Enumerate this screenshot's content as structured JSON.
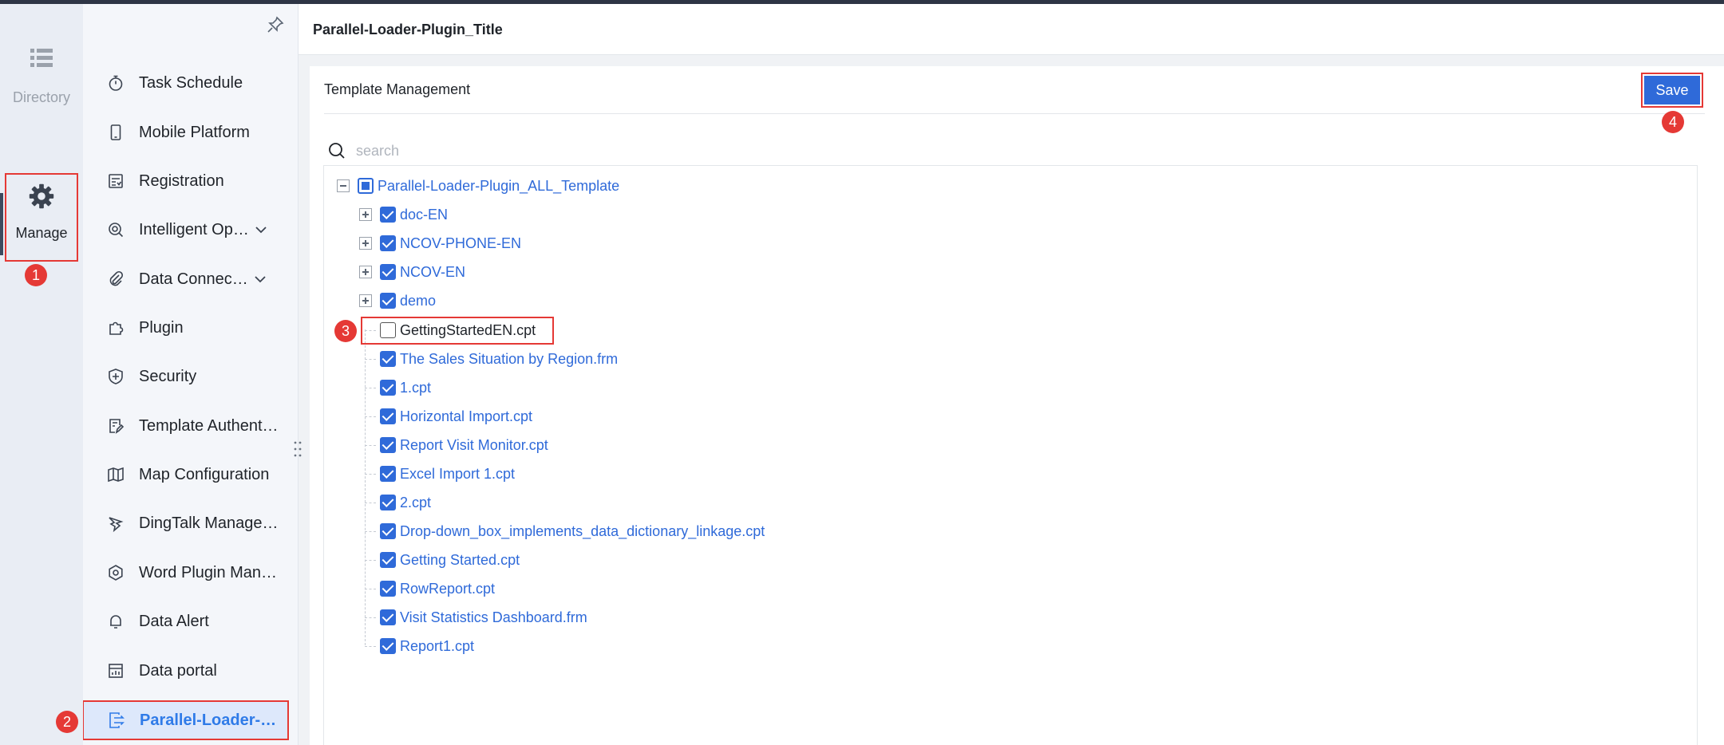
{
  "rail": {
    "directory_label": "Directory",
    "manage_label": "Manage"
  },
  "sidebar": {
    "items": [
      {
        "label": "Task Schedule",
        "icon": "stopwatch-icon"
      },
      {
        "label": "Mobile Platform",
        "icon": "mobile-icon"
      },
      {
        "label": "Registration",
        "icon": "registration-icon"
      },
      {
        "label": "Intelligent Op…",
        "icon": "intelligent-ops-icon",
        "expandable": true
      },
      {
        "label": "Data Connec…",
        "icon": "paperclip-icon",
        "expandable": true
      },
      {
        "label": "Plugin",
        "icon": "puzzle-icon"
      },
      {
        "label": "Security",
        "icon": "shield-icon"
      },
      {
        "label": "Template Authent…",
        "icon": "template-auth-icon"
      },
      {
        "label": "Map Configuration",
        "icon": "map-icon"
      },
      {
        "label": "DingTalk Manage…",
        "icon": "dingtalk-icon"
      },
      {
        "label": "Word Plugin Man…",
        "icon": "gear-icon"
      },
      {
        "label": "Data Alert",
        "icon": "bell-icon"
      },
      {
        "label": "Data portal",
        "icon": "portal-icon"
      },
      {
        "label": "Parallel-Loader-…",
        "icon": "parallel-loader-icon",
        "active": true
      }
    ]
  },
  "header": {
    "title": "Parallel-Loader-Plugin_Title"
  },
  "card": {
    "title": "Template Management",
    "save_label": "Save",
    "search_placeholder": "search"
  },
  "tree": {
    "root": "Parallel-Loader-Plugin_ALL_Template",
    "folders": [
      "doc-EN",
      "NCOV-PHONE-EN",
      "NCOV-EN",
      "demo"
    ],
    "files": [
      {
        "label": "GettingStartedEN.cpt",
        "checked": false
      },
      {
        "label": "The Sales Situation by Region.frm",
        "checked": true
      },
      {
        "label": "1.cpt",
        "checked": true
      },
      {
        "label": "Horizontal Import.cpt",
        "checked": true
      },
      {
        "label": "Report Visit Monitor.cpt",
        "checked": true
      },
      {
        "label": "Excel Import 1.cpt",
        "checked": true
      },
      {
        "label": "2.cpt",
        "checked": true
      },
      {
        "label": "Drop-down_box_implements_data_dictionary_linkage.cpt",
        "checked": true
      },
      {
        "label": "Getting Started.cpt",
        "checked": true
      },
      {
        "label": "RowReport.cpt",
        "checked": true
      },
      {
        "label": "Visit Statistics Dashboard.frm",
        "checked": true
      },
      {
        "label": "Report1.cpt",
        "checked": true
      }
    ]
  },
  "annotations": {
    "step1": "1",
    "step2": "2",
    "step3": "3",
    "step4": "4"
  },
  "colors": {
    "accent": "#2f6ad9",
    "annotation_red": "#e53935",
    "active_bg": "#dde8fb"
  }
}
